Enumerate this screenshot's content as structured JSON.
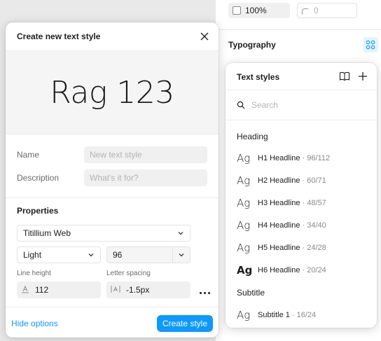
{
  "background": {
    "opacity_value": "100%",
    "radius_value": "0",
    "section_title": "Typography"
  },
  "dialog": {
    "title": "Create new text style",
    "preview_text": "Rag 123",
    "name_label": "Name",
    "name_placeholder": "New text style",
    "description_label": "Description",
    "description_placeholder": "What's it for?",
    "properties_title": "Properties",
    "font_family": "Titillium Web",
    "font_weight": "Light",
    "font_size": "96",
    "line_height_label": "Line height",
    "line_height_value": "112",
    "letter_spacing_label": "Letter spacing",
    "letter_spacing_value": "-1.5px",
    "hide_options": "Hide options",
    "create_button": "Create style"
  },
  "text_styles": {
    "title": "Text styles",
    "search_placeholder": "Search",
    "groups": [
      {
        "label": "Heading",
        "items": [
          {
            "sample": "Ag",
            "name": "H1 Headline",
            "meta": "· 96/112"
          },
          {
            "sample": "Ag",
            "name": "H2 Headline",
            "meta": "· 60/71"
          },
          {
            "sample": "Ag",
            "name": "H3 Headline",
            "meta": "· 48/57"
          },
          {
            "sample": "Ag",
            "name": "H4 Headline",
            "meta": "· 34/40"
          },
          {
            "sample": "Ag",
            "name": "H5 Headline",
            "meta": "· 24/28"
          },
          {
            "sample": "Ag",
            "name": "H6 Headline",
            "meta": "· 20/24"
          }
        ]
      },
      {
        "label": "Subtitle",
        "items": [
          {
            "sample": "Ag",
            "name": "Subtitle 1",
            "meta": "· 16/24"
          }
        ]
      }
    ]
  },
  "colors": {
    "accent": "#0d99ff",
    "accent_light": "#e5f4ff"
  }
}
